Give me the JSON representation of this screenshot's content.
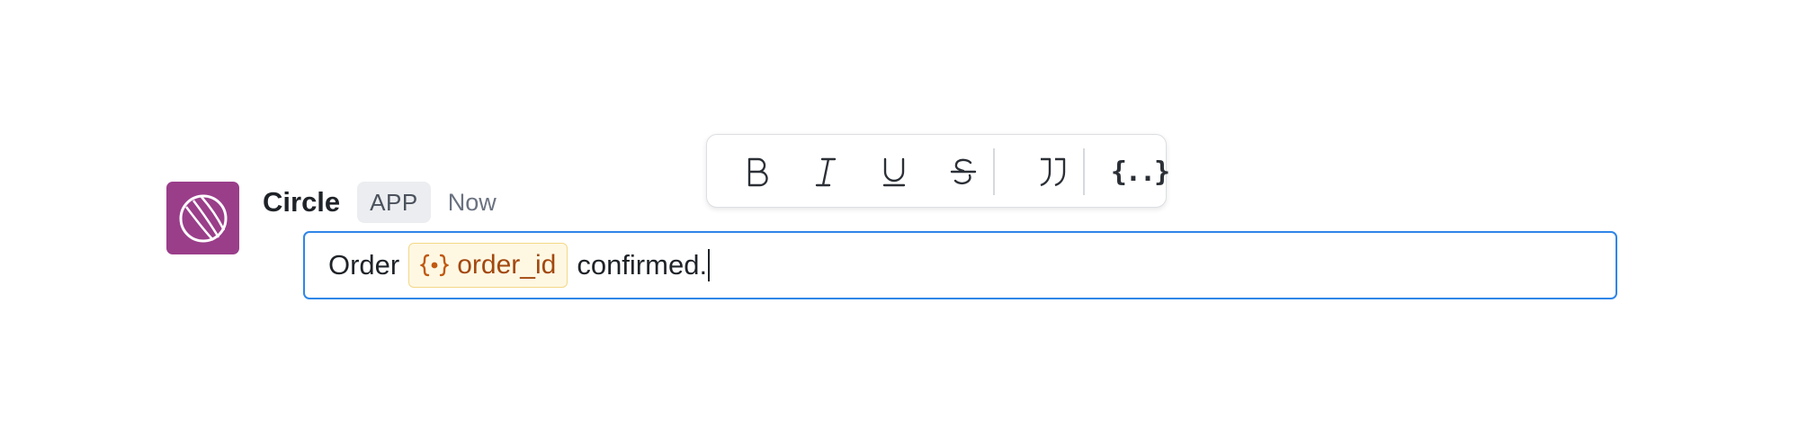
{
  "message": {
    "sender_name": "Circle",
    "badge_label": "APP",
    "timestamp": "Now",
    "avatar_color": "#9a3e8a"
  },
  "toolbar": {
    "buttons": [
      {
        "name": "bold-button",
        "icon": "bold-icon"
      },
      {
        "name": "italic-button",
        "icon": "italic-icon"
      },
      {
        "name": "underline-button",
        "icon": "underline-icon"
      },
      {
        "name": "strikethrough-button",
        "icon": "strikethrough-icon"
      },
      {
        "name": "quote-button",
        "icon": "quote-icon"
      },
      {
        "name": "variable-button",
        "icon": "variable-braces-icon",
        "label": "{..}"
      }
    ]
  },
  "editor": {
    "text_before": "Order",
    "variable_name": "order_id",
    "text_after": "confirmed.",
    "focus_color": "#2f86e8"
  }
}
